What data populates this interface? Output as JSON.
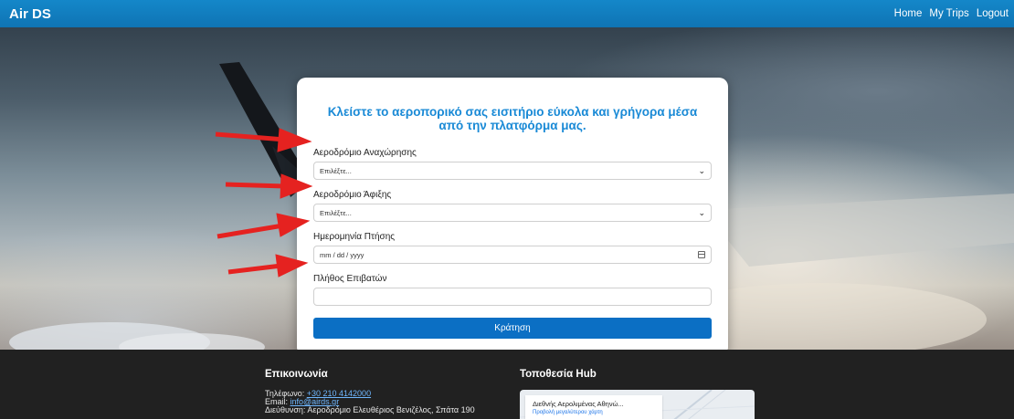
{
  "header": {
    "brand": "Air DS",
    "nav": [
      "Home",
      "My Trips",
      "Logout"
    ]
  },
  "form": {
    "heading": "Κλείστε το αεροπορικό σας εισιτήριο εύκολα και γρήγορα μέσα από την πλατφόρμα μας.",
    "departure": {
      "label": "Αεροδρόμιο Αναχώρησης",
      "value": "Επιλέξτε..."
    },
    "arrival": {
      "label": "Αεροδρόμιο Άφιξης",
      "value": "Επιλέξτε..."
    },
    "date": {
      "label": "Ημερομηνία Πτήσης",
      "placeholder": "mm / dd / yyyy"
    },
    "passengers": {
      "label": "Πλήθος Επιβατών",
      "value": ""
    },
    "submit": "Κράτηση"
  },
  "footer": {
    "contact_heading": "Επικοινωνία",
    "phone_label": "Τηλέφωνο:",
    "phone": "+30 210 4142000",
    "email_label": "Email:",
    "email": "info@airds.gr",
    "address": "Διεύθυνση: Αεροδρόμιο Ελευθέριος Βενιζέλος, Σπάτα 190",
    "hub_heading": "Τοποθεσία Hub",
    "map_title": "Διεθνής Αερολιμένας Αθηνώ...",
    "map_link": "Προβολή μεγαλύτερου χάρτη"
  },
  "colors": {
    "header": "#1487c9",
    "accent": "#1a8ad6",
    "button": "#0b6fc4",
    "annotation_arrow": "#e52220",
    "footer": "#212121"
  },
  "icons": [
    "dropdown-caret-icon",
    "calendar-icon",
    "annotation-arrow"
  ]
}
